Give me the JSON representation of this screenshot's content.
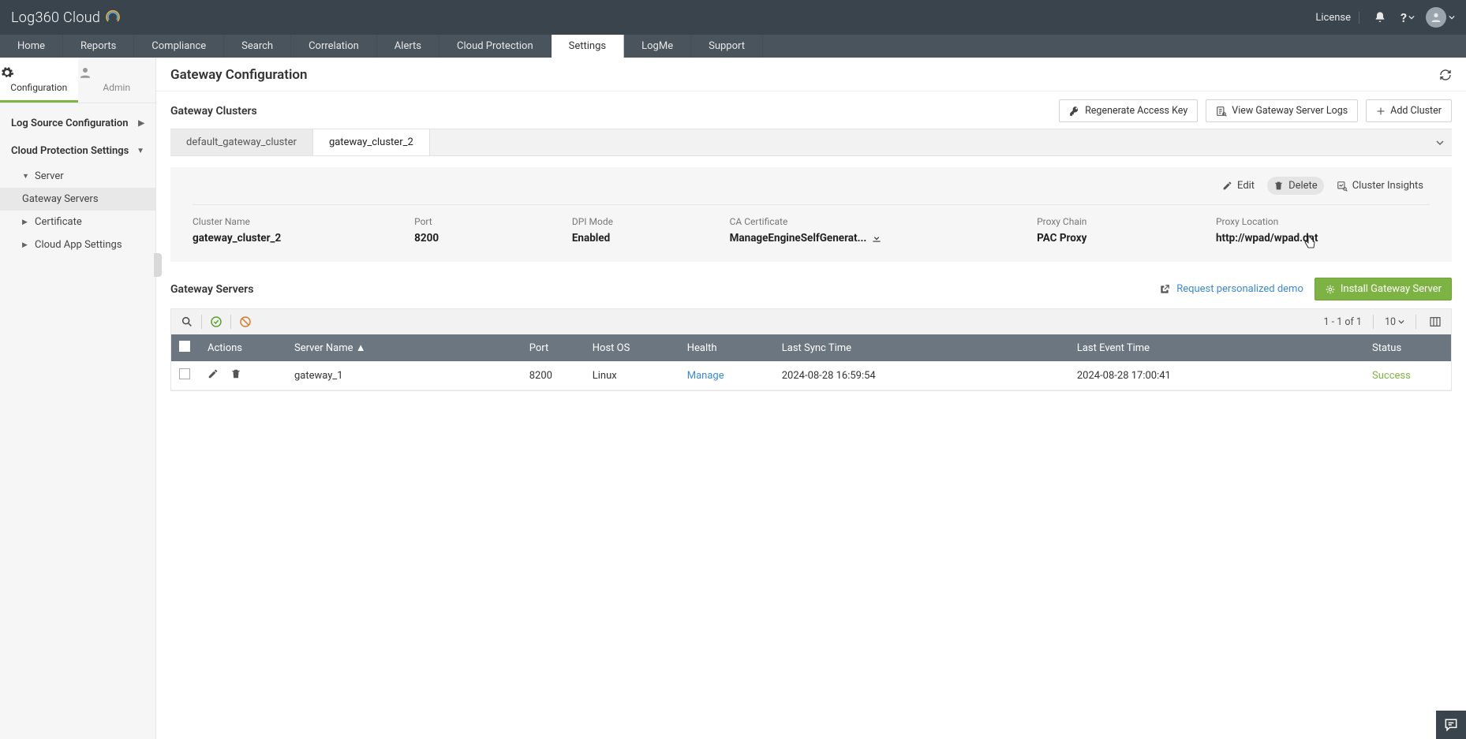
{
  "header": {
    "logo_text": "Log360 Cloud",
    "license_label": "License"
  },
  "nav_tabs": [
    "Home",
    "Reports",
    "Compliance",
    "Search",
    "Correlation",
    "Alerts",
    "Cloud Protection",
    "Settings",
    "LogMe",
    "Support"
  ],
  "nav_active": "Settings",
  "subtabs": {
    "config": "Configuration",
    "admin": "Admin"
  },
  "sidebar": {
    "log_source": "Log Source Configuration",
    "cloud_protection": "Cloud Protection Settings",
    "server": "Server",
    "gateway_servers": "Gateway Servers",
    "certificate": "Certificate",
    "cloud_app": "Cloud App Settings"
  },
  "page": {
    "title": "Gateway Configuration",
    "clusters_title": "Gateway Clusters",
    "regen_key": "Regenerate Access Key",
    "view_logs": "View Gateway Server Logs",
    "add_cluster": "Add Cluster"
  },
  "cluster_tabs": [
    "default_gateway_cluster",
    "gateway_cluster_2"
  ],
  "cluster_actions": {
    "edit": "Edit",
    "delete": "Delete",
    "insights": "Cluster Insights"
  },
  "cluster_details": {
    "cluster_name_label": "Cluster Name",
    "cluster_name": "gateway_cluster_2",
    "port_label": "Port",
    "port": "8200",
    "dpi_label": "DPI Mode",
    "dpi": "Enabled",
    "ca_label": "CA Certificate",
    "ca": "ManageEngineSelfGenerat...",
    "proxy_chain_label": "Proxy Chain",
    "proxy_chain": "PAC Proxy",
    "proxy_loc_label": "Proxy Location",
    "proxy_loc": "http://wpad/wpad.dat"
  },
  "servers": {
    "title": "Gateway Servers",
    "demo_link": "Request personalized demo",
    "install_btn": "Install Gateway Server",
    "pagination": "1 - 1 of 1",
    "page_size": "10",
    "columns": {
      "actions": "Actions",
      "server_name": "Server Name",
      "port": "Port",
      "host_os": "Host OS",
      "health": "Health",
      "last_sync": "Last Sync Time",
      "last_event": "Last Event Time",
      "status": "Status"
    },
    "rows": [
      {
        "server_name": "gateway_1",
        "port": "8200",
        "host_os": "Linux",
        "health": "Manage",
        "last_sync": "2024-08-28 16:59:54",
        "last_event": "2024-08-28 17:00:41",
        "status": "Success"
      }
    ]
  }
}
